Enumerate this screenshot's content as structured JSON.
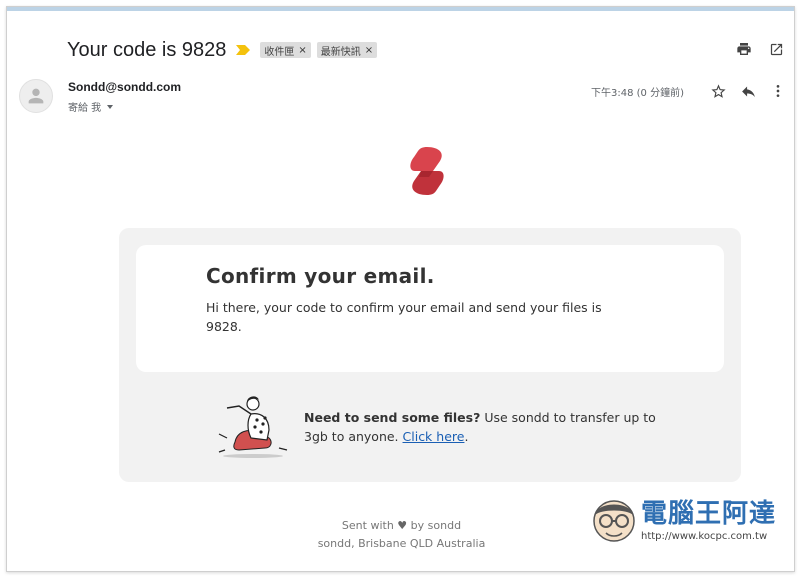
{
  "subject": {
    "title": "Your code is 9828",
    "labels": [
      {
        "text": "收件匣",
        "close": "×"
      },
      {
        "text": "最新快訊",
        "close": "×"
      }
    ]
  },
  "sender": {
    "email": "Sondd@sondd.com",
    "recipient": "寄給 我",
    "timestamp": "下午3:48 (0 分鐘前)"
  },
  "email_body": {
    "heading": "Confirm your email.",
    "message": "Hi there, your code to confirm your email and send your files is 9828.",
    "promo_bold": "Need to send some files?",
    "promo_text": " Use sondd to transfer up to 3gb to anyone. ",
    "promo_link": "Click here",
    "promo_end": "."
  },
  "footer": {
    "sent_with": "Sent with",
    "by": "by sondd",
    "address": "sondd, Brisbane QLD Australia"
  },
  "watermark": {
    "title": "電腦王阿達",
    "url": "http://www.kocpc.com.tw"
  },
  "icons": {
    "importance": "importance-marker-icon",
    "print": "print-icon",
    "open_new_window": "open-in-new-window-icon",
    "star": "star-icon",
    "reply": "reply-icon",
    "more": "more-vert-icon",
    "avatar": "person-icon",
    "logo": "sondd-logo-icon",
    "heart": "heart-icon"
  },
  "colors": {
    "logo_red": "#d9444d",
    "link": "#1a5fb4",
    "importance_yellow": "#f4c20d"
  }
}
